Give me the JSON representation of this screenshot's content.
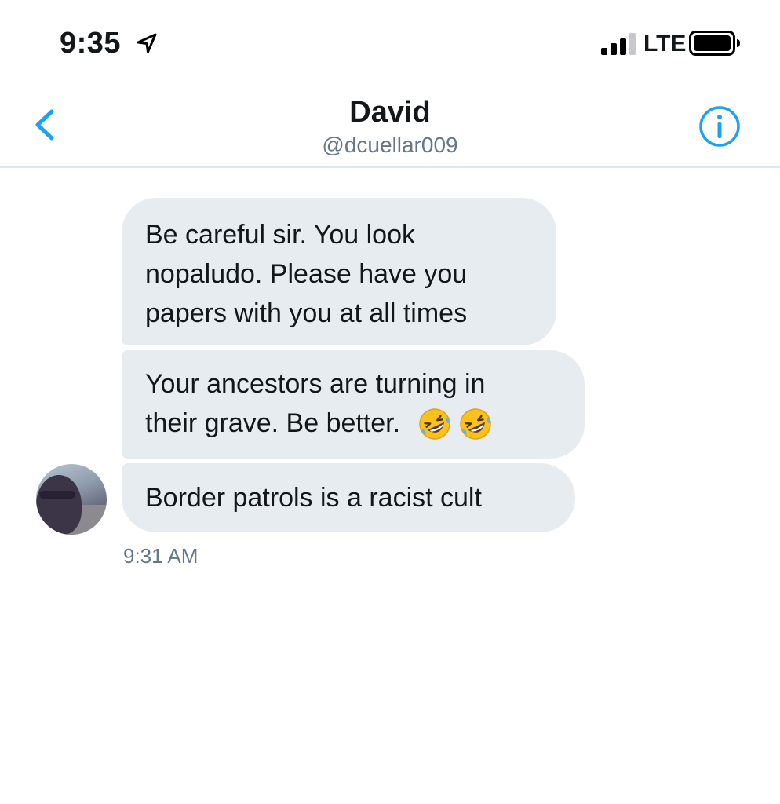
{
  "status_bar": {
    "time": "9:35",
    "network": "LTE",
    "location_icon": "location-arrow-icon",
    "signal_icon": "cellular-signal-icon",
    "battery_icon": "battery-full-icon"
  },
  "header": {
    "name": "David",
    "handle": "@dcuellar009",
    "back_icon": "chevron-left-icon",
    "info_icon": "info-circle-icon"
  },
  "messages": [
    {
      "lines": [
        "Be careful sir. You look",
        "nopaludo. Please have you",
        "papers with you at all times"
      ]
    },
    {
      "lines": [
        "Your ancestors are turning in",
        "their grave. Be better."
      ],
      "emoji": [
        "rolling-on-floor-laughing-icon",
        "rolling-on-floor-laughing-icon"
      ]
    },
    {
      "lines": [
        "Border patrols is a racist cult"
      ]
    }
  ],
  "timestamp": "9:31 AM",
  "colors": {
    "accent": "#1da1f2",
    "bubble_background": "#e6ecf0",
    "text_primary": "#14171a",
    "text_secondary": "#657786",
    "divider": "#e1e8ed"
  }
}
